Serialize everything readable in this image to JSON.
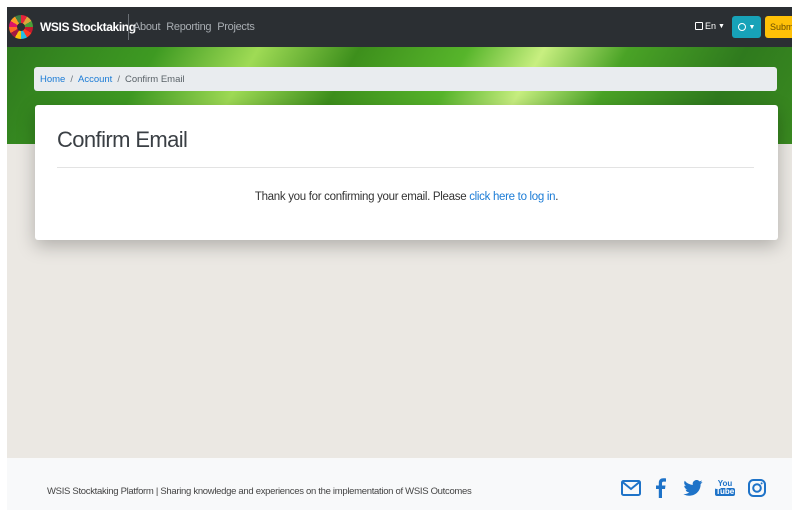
{
  "navbar": {
    "brand": "WSIS Stocktaking",
    "links": [
      "About",
      "Reporting",
      "Projects"
    ],
    "language": "En",
    "submit_label": "Submi"
  },
  "breadcrumb": {
    "items": [
      "Home",
      "Account"
    ],
    "current": "Confirm Email"
  },
  "card": {
    "title": "Confirm Email",
    "message_prefix": "Thank you for confirming your email. Please ",
    "message_link": "click here to log in",
    "message_suffix": "."
  },
  "footer": {
    "text": "WSIS Stocktaking Platform | Sharing knowledge and experiences on the implementation of WSIS Outcomes",
    "social_icons": [
      "email-icon",
      "facebook-icon",
      "twitter-icon",
      "youtube-icon",
      "instagram-icon"
    ],
    "youtube_label_top": "You",
    "youtube_label_bottom": "Tube"
  },
  "colors": {
    "navbar_bg": "#2b2f33",
    "link_blue": "#1a7bd6",
    "info_button": "#17a2b8",
    "submit_button": "#ffc107"
  }
}
